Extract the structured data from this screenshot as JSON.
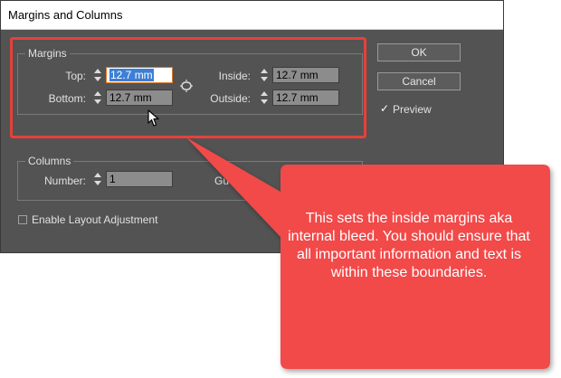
{
  "dialog": {
    "title": "Margins and Columns",
    "margins": {
      "group_label": "Margins",
      "top_label": "Top:",
      "top_value": "12.7 mm",
      "bottom_label": "Bottom:",
      "bottom_value": "12.7 mm",
      "inside_label": "Inside:",
      "inside_value": "12.7 mm",
      "outside_label": "Outside:",
      "outside_value": "12.7 mm"
    },
    "columns": {
      "group_label": "Columns",
      "number_label": "Number:",
      "number_value": "1",
      "gutter_label_partial": "Gu"
    },
    "enable_layout_adjustment_label": "Enable Layout Adjustment",
    "enable_layout_adjustment_checked": false,
    "buttons": {
      "ok": "OK",
      "cancel": "Cancel"
    },
    "preview_label": "Preview",
    "preview_checked": true
  },
  "annotation": {
    "text": "This sets the inside margins aka internal bleed. You should ensure that all important information and text is within these boundaries.",
    "color": "#f2494a",
    "outline_color": "#e5413b"
  },
  "icons": [
    "link-chain-icon",
    "mouse-pointer-icon",
    "checkmark-icon"
  ]
}
